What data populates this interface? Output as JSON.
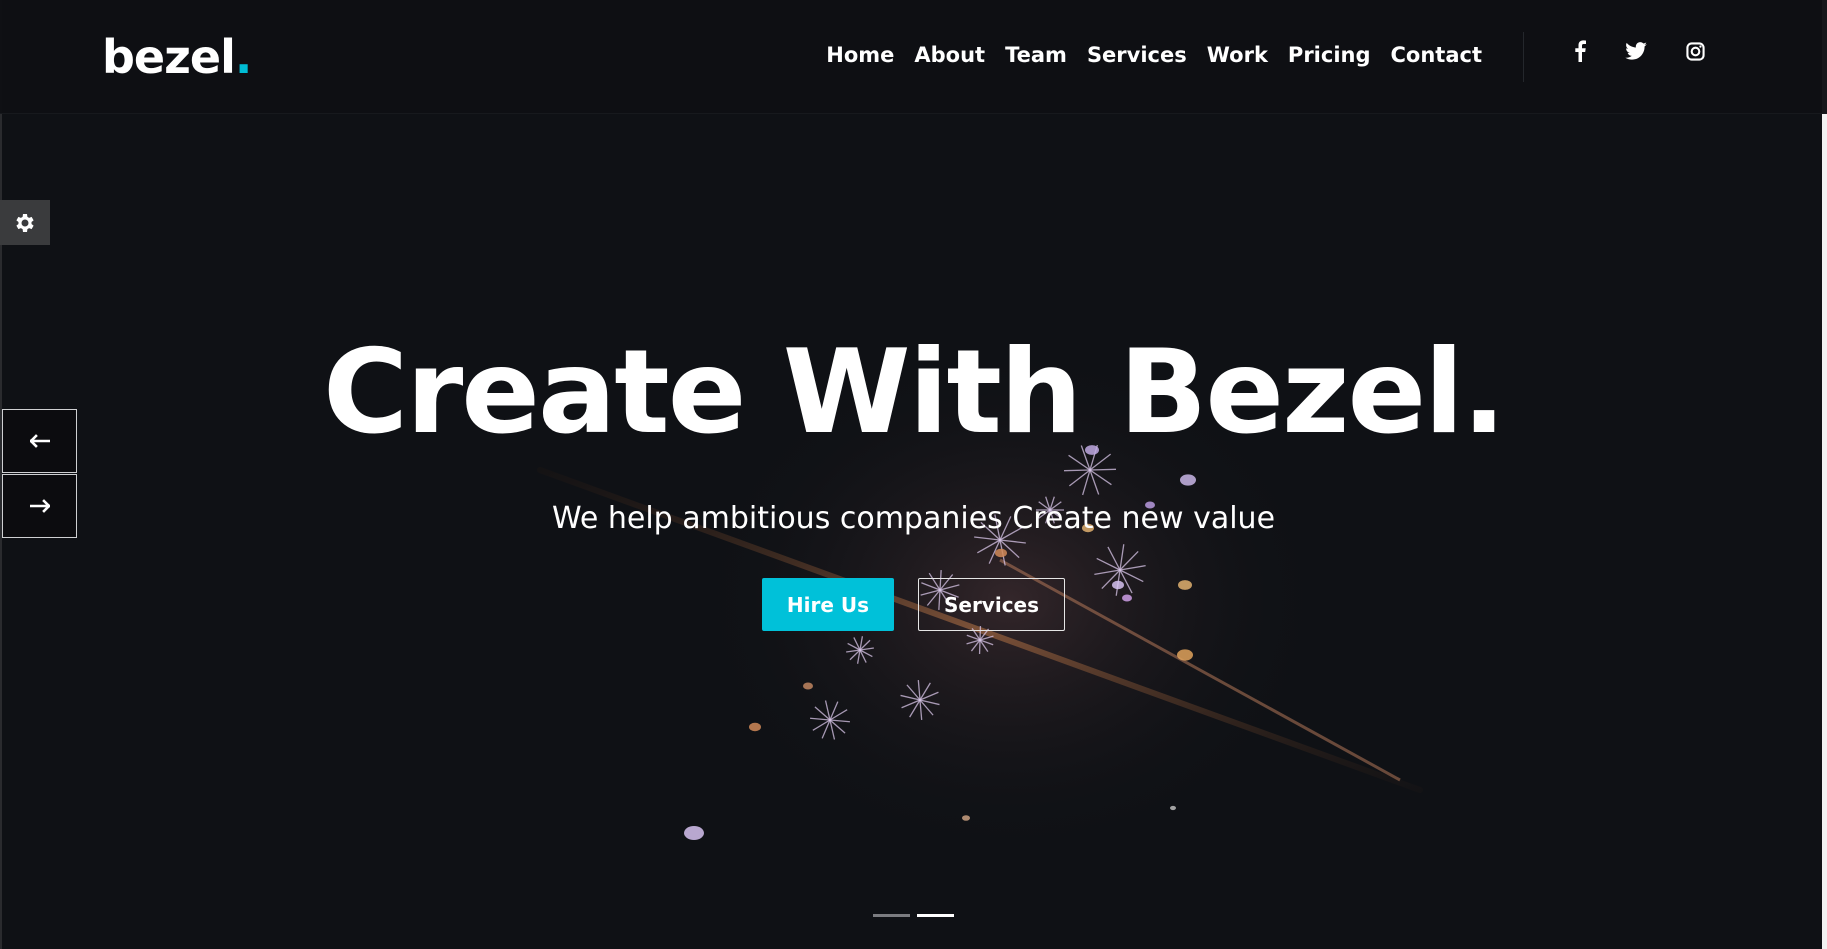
{
  "brand": {
    "name": "bezel",
    "dot": ".",
    "accent_color": "#00bcd4"
  },
  "nav": {
    "items": [
      {
        "label": "Home"
      },
      {
        "label": "About"
      },
      {
        "label": "Team"
      },
      {
        "label": "Services"
      },
      {
        "label": "Work"
      },
      {
        "label": "Pricing"
      },
      {
        "label": "Contact"
      }
    ],
    "social": [
      {
        "icon": "facebook-icon"
      },
      {
        "icon": "twitter-icon"
      },
      {
        "icon": "instagram-icon"
      }
    ]
  },
  "settings": {
    "icon": "gear-icon"
  },
  "slider": {
    "prev_icon": "arrow-left-icon",
    "next_icon": "arrow-right-icon",
    "slides_count": 2,
    "active_slide": 2
  },
  "hero": {
    "title": "Create With Bezel.",
    "subtitle": "We help ambitious companies Create new value",
    "primary_button": "Hire Us",
    "secondary_button": "Services",
    "primary_color": "#00c1d9"
  }
}
